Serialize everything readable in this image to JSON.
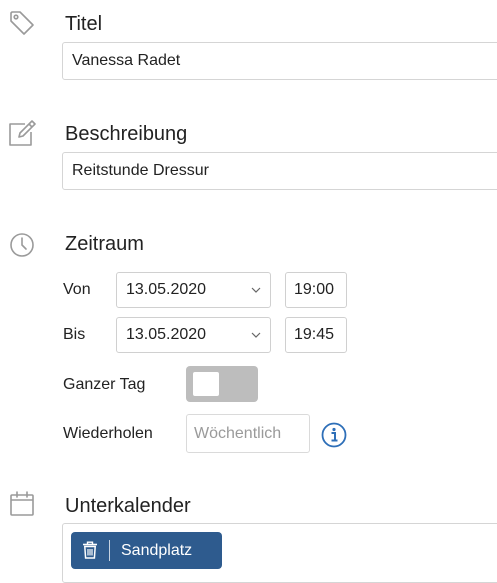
{
  "icons": {
    "title": "tag-icon",
    "description": "edit-icon",
    "period": "clock-icon",
    "calendar": "calendar-icon",
    "info": "info-icon",
    "trash": "trash-icon",
    "chevron": "chevron-down-icon"
  },
  "colors": {
    "chip_bg": "#2e5b8e",
    "info_accent": "#2e6fb8",
    "toggle_off": "#bdbdbd",
    "icon_gray": "#9a9a9a"
  },
  "title_section": {
    "label": "Titel",
    "value": "Vanessa Radet"
  },
  "description_section": {
    "label": "Beschreibung",
    "value": "Reitstunde Dressur"
  },
  "period_section": {
    "label": "Zeitraum",
    "from": {
      "label": "Von",
      "date": "13.05.2020",
      "time": "19:00"
    },
    "to": {
      "label": "Bis",
      "date": "13.05.2020",
      "time": "19:45"
    },
    "all_day": {
      "label": "Ganzer Tag",
      "enabled": false
    },
    "repeat": {
      "label": "Wiederholen",
      "value": "Wöchentlich"
    }
  },
  "subcalendar_section": {
    "label": "Unterkalender",
    "chips": [
      {
        "label": "Sandplatz"
      }
    ]
  }
}
